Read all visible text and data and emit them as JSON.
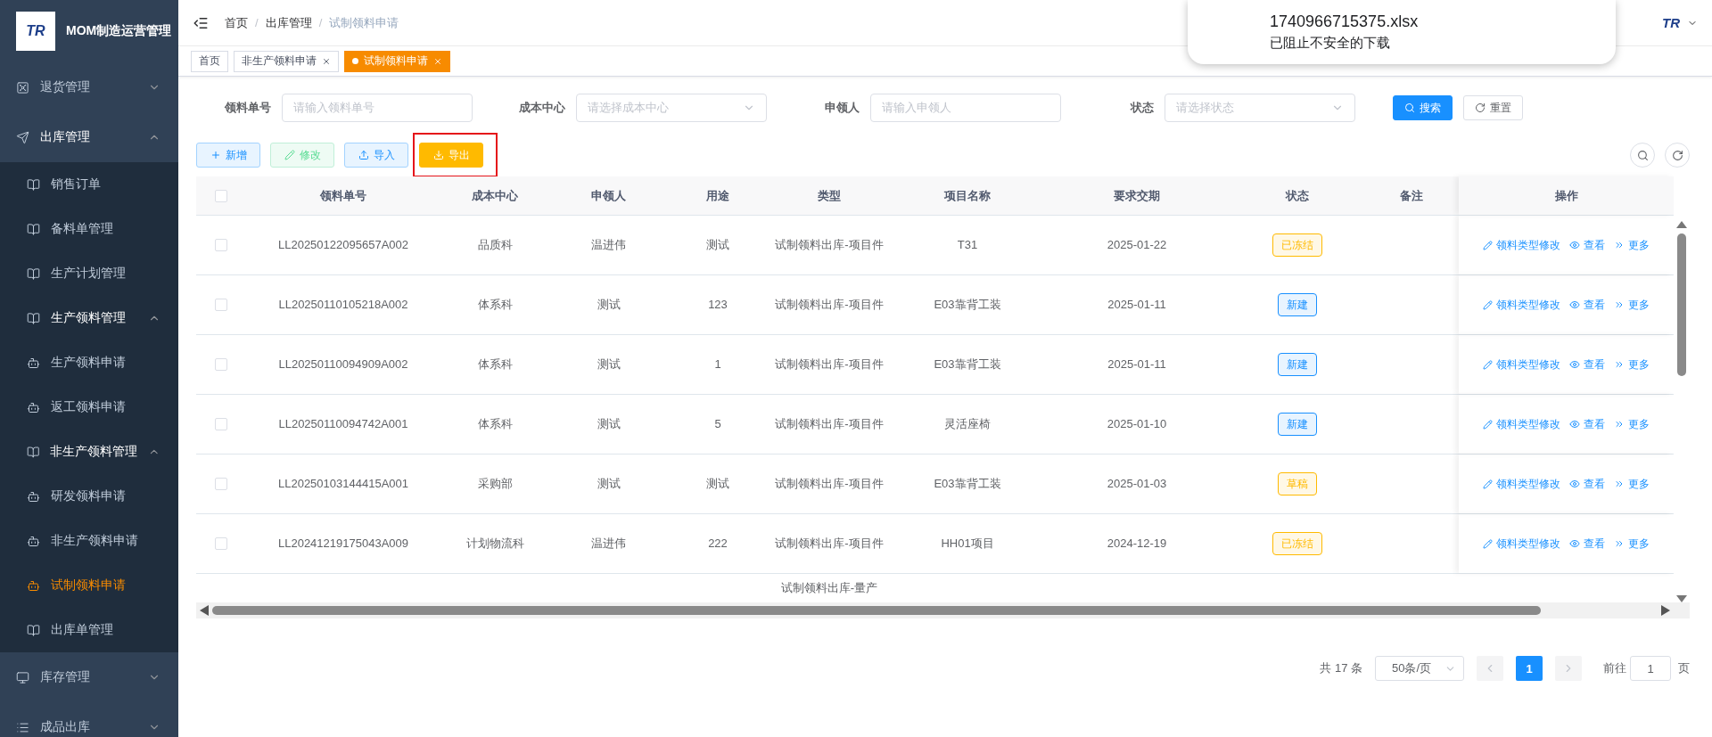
{
  "sidebar": {
    "logo": "TR",
    "title": "MOM制造运营管理",
    "menu": [
      {
        "label": "退货管理",
        "kind": "safe",
        "expanded": false,
        "selected": false
      },
      {
        "label": "出库管理",
        "kind": "plane",
        "expanded": true,
        "selected": false,
        "children": [
          {
            "label": "销售订单",
            "kind": "book",
            "selected": false
          },
          {
            "label": "备料单管理",
            "kind": "book",
            "selected": false
          },
          {
            "label": "生产计划管理",
            "kind": "book",
            "selected": false
          },
          {
            "label": "生产领料管理",
            "kind": "book",
            "expanded": true,
            "selected": false,
            "children": [
              {
                "label": "生产领料申请",
                "kind": "robot",
                "selected": false
              },
              {
                "label": "返工领料申请",
                "kind": "robot",
                "selected": false
              }
            ]
          },
          {
            "label": "非生产领料管理",
            "kind": "book",
            "expanded": true,
            "selected": false,
            "children": [
              {
                "label": "研发领料申请",
                "kind": "robot",
                "selected": false
              },
              {
                "label": "非生产领料申请",
                "kind": "robot",
                "selected": false
              },
              {
                "label": "试制领料申请",
                "kind": "robot",
                "selected": true
              }
            ]
          },
          {
            "label": "出库单管理",
            "kind": "book",
            "selected": false
          }
        ]
      },
      {
        "label": "库存管理",
        "kind": "monitor",
        "expanded": false,
        "selected": false
      },
      {
        "label": "成品出库",
        "kind": "list",
        "expanded": false,
        "selected": false
      }
    ]
  },
  "header": {
    "breadcrumb": [
      "首页",
      "出库管理",
      "试制领料申请"
    ],
    "breadcrumb_separator": "/",
    "logo": "TR"
  },
  "download_popup": {
    "filename": "1740966715375.xlsx",
    "message": "已阻止不安全的下载"
  },
  "tags": [
    {
      "label": "首页",
      "selected": false,
      "closable": false
    },
    {
      "label": "非生产领料申请",
      "selected": false,
      "closable": true
    },
    {
      "label": "试制领料申请",
      "selected": true,
      "closable": true
    }
  ],
  "filters": [
    {
      "label": "领料单号",
      "kind": "input",
      "placeholder": "请输入领料单号"
    },
    {
      "label": "成本中心",
      "kind": "select",
      "placeholder": "请选择成本中心"
    },
    {
      "label": "申领人",
      "kind": "input",
      "placeholder": "请输入申领人"
    },
    {
      "label": "状态",
      "kind": "select",
      "placeholder": "请选择状态"
    }
  ],
  "search_buttons": [
    {
      "label": "搜索",
      "kind": "search"
    },
    {
      "label": "重置",
      "kind": "reset"
    }
  ],
  "toolbar": [
    {
      "label": "新增",
      "kind": "add",
      "highlighted": false
    },
    {
      "label": "修改",
      "kind": "edit",
      "highlighted": false
    },
    {
      "label": "导入",
      "kind": "import",
      "highlighted": false
    },
    {
      "label": "导出",
      "kind": "export",
      "highlighted": true
    }
  ],
  "table": {
    "select_all": false,
    "columns": [
      "领料单号",
      "成本中心",
      "申领人",
      "用途",
      "类型",
      "项目名称",
      "要求交期",
      "状态",
      "备注",
      "操作"
    ],
    "rows": [
      {
        "selected": false,
        "no": "LL20250122095657A002",
        "cost_center": "品质科",
        "applicant": "温进伟",
        "purpose": "测试",
        "type": "试制领料出库-项目件",
        "project": "T31",
        "due": "2025-01-22",
        "status": {
          "label": "已冻结",
          "kind": "warning"
        },
        "actions": [
          "领料类型修改",
          "查看",
          "更多"
        ]
      },
      {
        "selected": false,
        "no": "LL20250110105218A002",
        "cost_center": "体系科",
        "applicant": "测试",
        "purpose": "123",
        "type": "试制领料出库-项目件",
        "project": "E03靠背工装",
        "due": "2025-01-11",
        "status": {
          "label": "新建",
          "kind": "primary"
        },
        "actions": [
          "领料类型修改",
          "查看",
          "更多"
        ]
      },
      {
        "selected": false,
        "no": "LL20250110094909A002",
        "cost_center": "体系科",
        "applicant": "测试",
        "purpose": "1",
        "type": "试制领料出库-项目件",
        "project": "E03靠背工装",
        "due": "2025-01-11",
        "status": {
          "label": "新建",
          "kind": "primary"
        },
        "actions": [
          "领料类型修改",
          "查看",
          "更多"
        ]
      },
      {
        "selected": false,
        "no": "LL20250110094742A001",
        "cost_center": "体系科",
        "applicant": "测试",
        "purpose": "5",
        "type": "试制领料出库-项目件",
        "project": "灵活座椅",
        "due": "2025-01-10",
        "status": {
          "label": "新建",
          "kind": "primary"
        },
        "actions": [
          "领料类型修改",
          "查看",
          "更多"
        ]
      },
      {
        "selected": false,
        "no": "LL20250103144415A001",
        "cost_center": "采购部",
        "applicant": "测试",
        "purpose": "测试",
        "type": "试制领料出库-项目件",
        "project": "E03靠背工装",
        "due": "2025-01-03",
        "status": {
          "label": "草稿",
          "kind": "warning"
        },
        "actions": [
          "领料类型修改",
          "查看",
          "更多"
        ]
      },
      {
        "selected": false,
        "no": "LL20241219175043A009",
        "cost_center": "计划物流科",
        "applicant": "温进伟",
        "purpose": "222",
        "type": "试制领料出库-项目件",
        "project": "HH01项目",
        "due": "2024-12-19",
        "status": {
          "label": "已冻结",
          "kind": "warning"
        },
        "actions": [
          "领料类型修改",
          "查看",
          "更多"
        ]
      },
      {
        "type": "试制领料出库-量产"
      }
    ]
  },
  "pagination": {
    "total": "共 17 条",
    "page_size": "50条/页",
    "pages": [
      {
        "label": "1",
        "selected": true
      }
    ],
    "goto_label": "前往",
    "goto_value": "1",
    "goto_suffix": "页"
  }
}
